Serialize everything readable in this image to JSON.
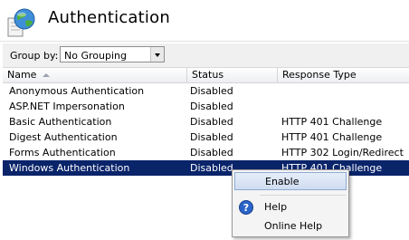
{
  "header": {
    "title": "Authentication",
    "icon": "globe-page-icon"
  },
  "toolbar": {
    "group_by_label": "Group by:",
    "group_by_value": "No Grouping"
  },
  "columns": {
    "name": "Name",
    "status": "Status",
    "response_type": "Response Type"
  },
  "rows": [
    {
      "name": "Anonymous Authentication",
      "status": "Disabled",
      "response_type": ""
    },
    {
      "name": "ASP.NET Impersonation",
      "status": "Disabled",
      "response_type": ""
    },
    {
      "name": "Basic Authentication",
      "status": "Disabled",
      "response_type": "HTTP 401 Challenge"
    },
    {
      "name": "Digest Authentication",
      "status": "Disabled",
      "response_type": "HTTP 401 Challenge"
    },
    {
      "name": "Forms Authentication",
      "status": "Disabled",
      "response_type": "HTTP 302 Login/Redirect"
    },
    {
      "name": "Windows Authentication",
      "status": "Disabled",
      "response_type": "HTTP 401 Challenge"
    }
  ],
  "selected_row": 5,
  "context_menu": {
    "enable": "Enable",
    "help": "Help",
    "online_help": "Online Help"
  },
  "colors": {
    "selection": "#0a246a",
    "menu_hover_border": "#8faad4"
  }
}
